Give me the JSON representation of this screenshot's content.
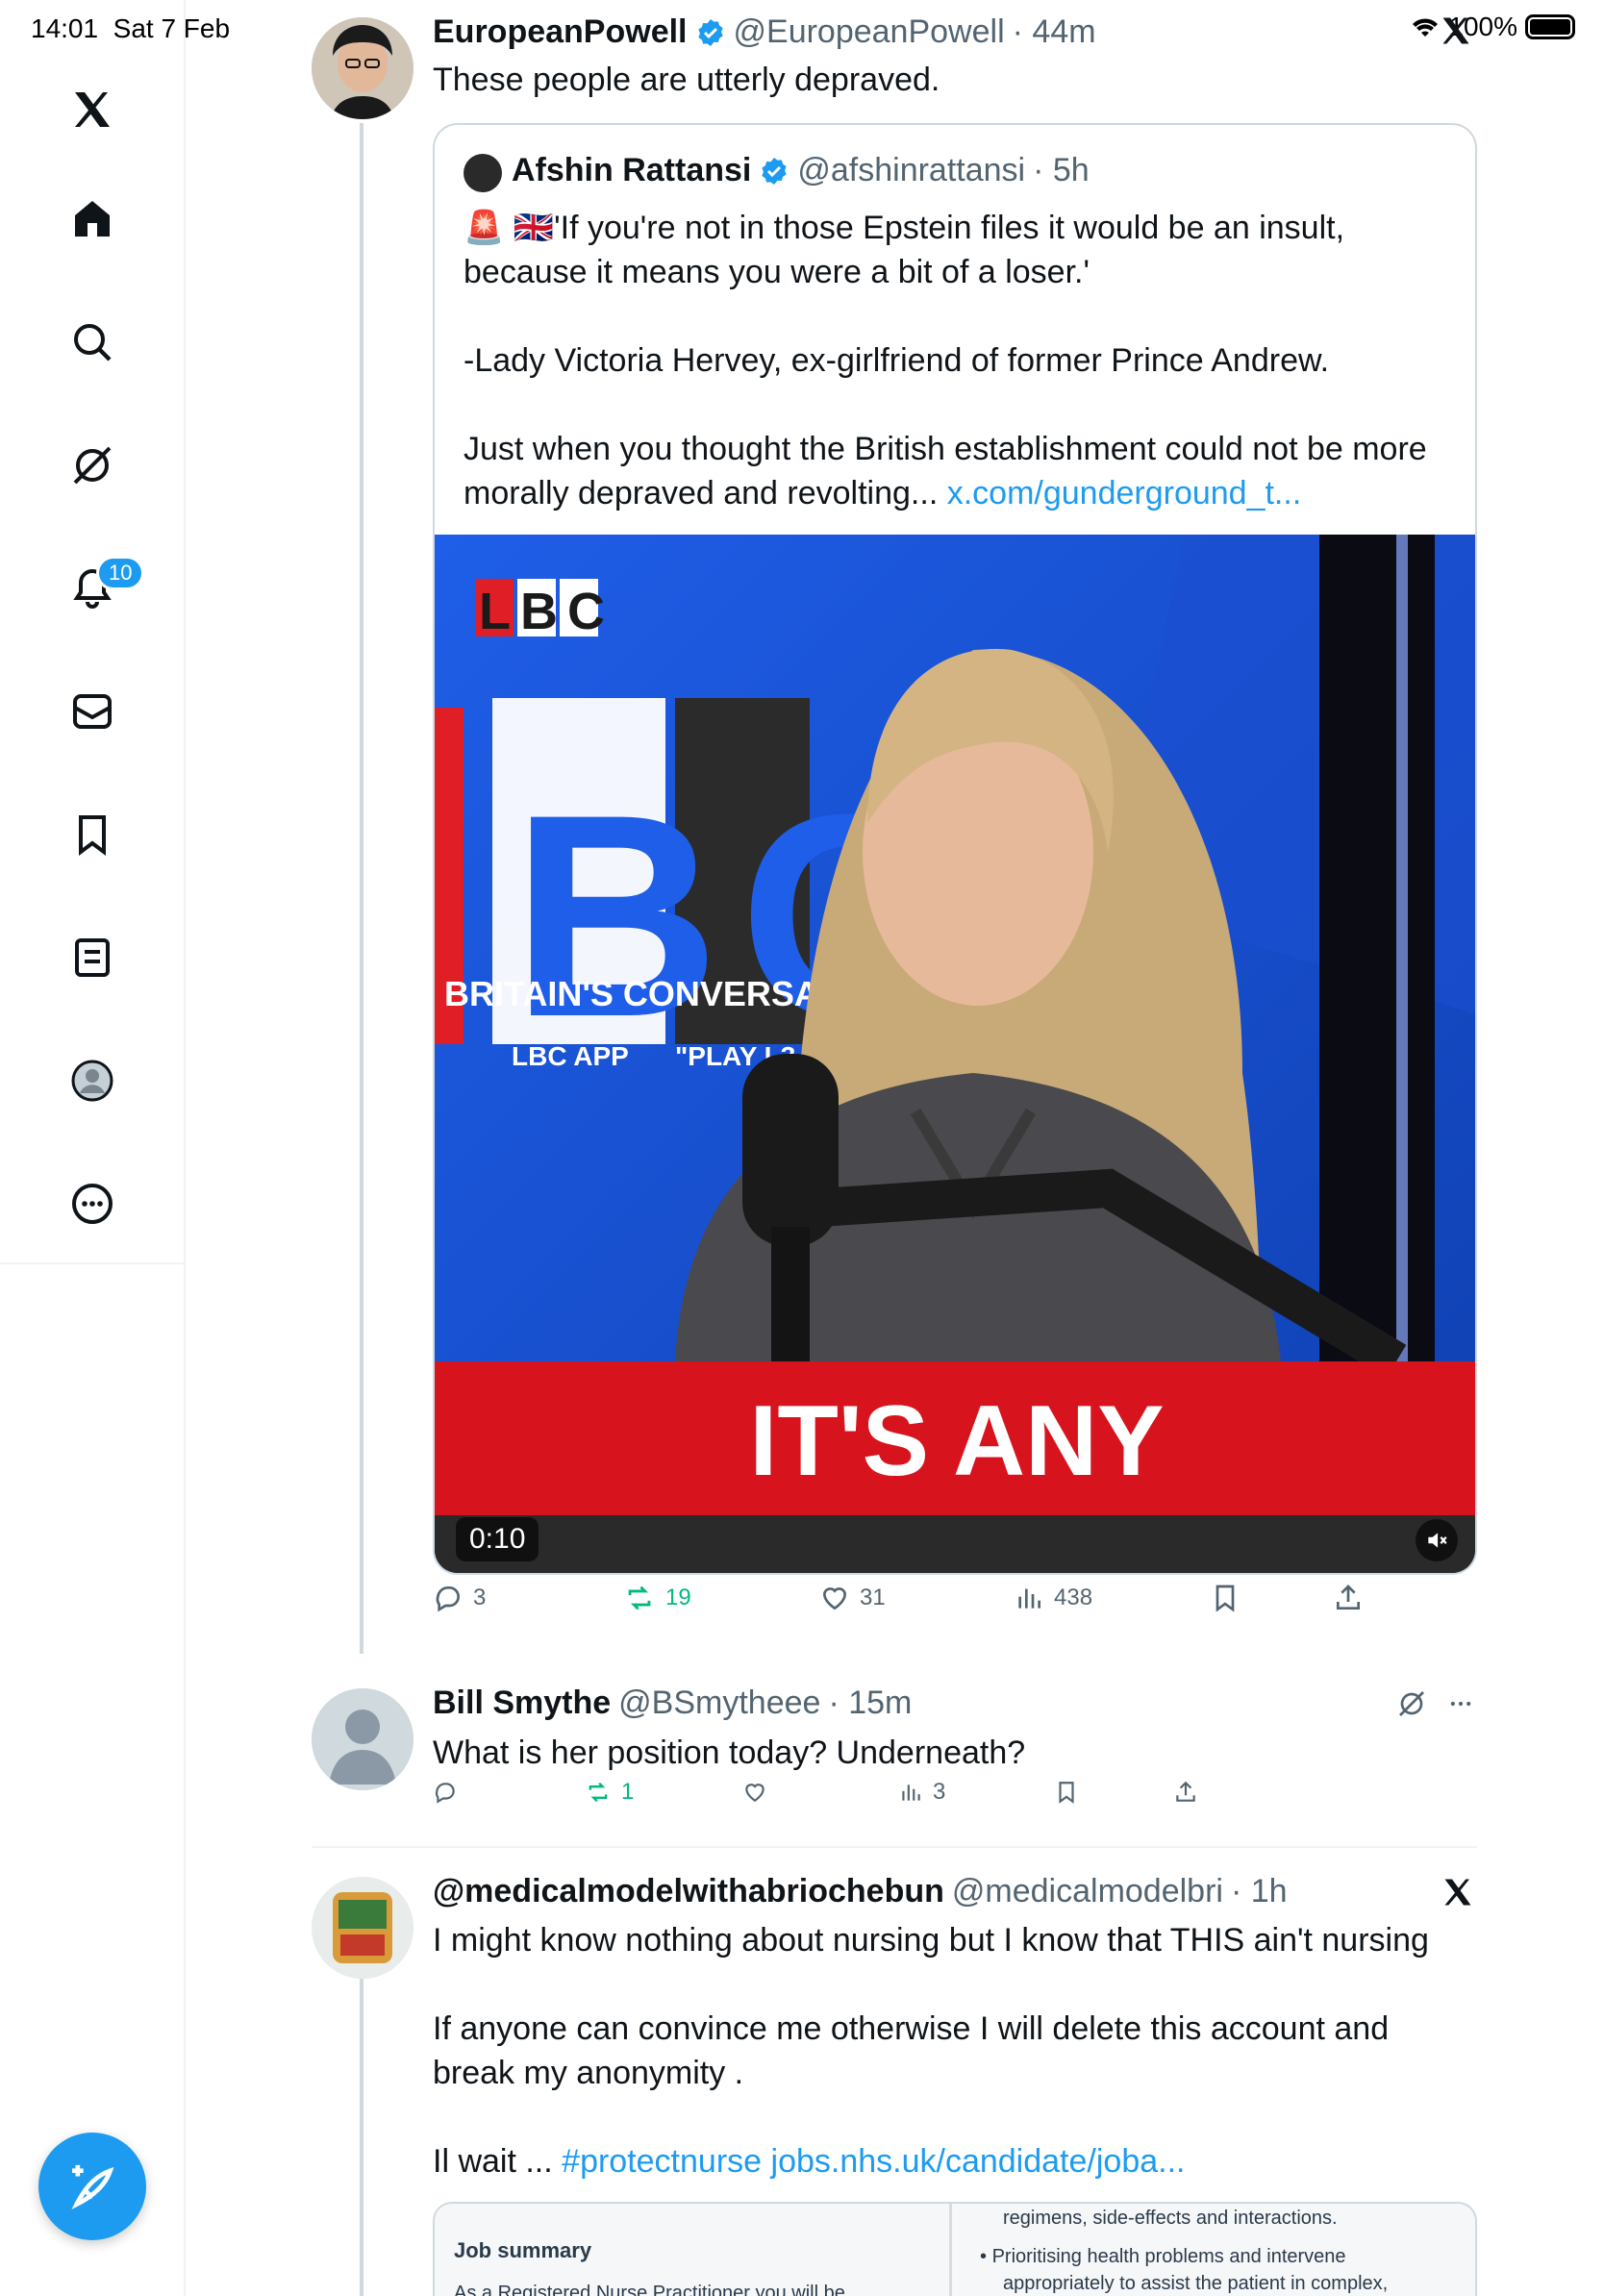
{
  "status_bar": {
    "time": "14:01",
    "date": "Sat 7 Feb",
    "battery": "100%"
  },
  "sidebar": {
    "items": [
      {
        "name": "x-logo"
      },
      {
        "name": "home"
      },
      {
        "name": "explore"
      },
      {
        "name": "grok"
      },
      {
        "name": "notifications",
        "badge": "10"
      },
      {
        "name": "messages"
      },
      {
        "name": "bookmarks"
      },
      {
        "name": "lists"
      },
      {
        "name": "profile"
      },
      {
        "name": "more"
      }
    ]
  },
  "main_tweet": {
    "name": "EuropeanPowell",
    "handle": "@EuropeanPowell",
    "time": "· 44m",
    "text": "These people are utterly depraved.",
    "quote": {
      "name": "Afshin Rattansi",
      "handle": "@afshinrattansi",
      "time": "· 5h",
      "emoji": "🚨 🇬🇧",
      "line1": "'If you're not in those Epstein files it would be an insult,",
      "line2": "because it means you were a bit of a loser.'",
      "line3": "-Lady Victoria Hervey, ex-girlfriend of former Prince Andrew.",
      "line4": "Just when you thought the British establishment could not be more",
      "line5": "morally depraved and revolting...",
      "link": "x.com/gunderground_t...",
      "video": {
        "duration": "0:10",
        "logo": "LBC",
        "big_logo": "BC",
        "tagline": "BRITAIN'S CONVERSATIO",
        "app_text": "LBC APP",
        "play_text": "\"PLAY L3",
        "caption": "IT'S ANY"
      }
    },
    "stats": {
      "replies": "3",
      "reposts": "19",
      "likes": "31",
      "views": "438"
    }
  },
  "reply": {
    "name": "Bill Smythe",
    "handle": "@BSmytheee",
    "time": "· 15m",
    "text": "What is her position today? Underneath?",
    "stats": {
      "reposts": "1",
      "views": "3"
    }
  },
  "third_tweet": {
    "name": "@medicalmodelwithabriochebun",
    "handle": "@medicalmodelbri",
    "time": "· 1h",
    "line1": "I might know nothing about nursing but I know that THIS ain't nursing",
    "line2": "If anyone can convince me otherwise I will delete this account and",
    "line3": "break my anonymity .",
    "line4": "Il wait ...",
    "hashtag": "#protectnurse",
    "link": "jobs.nhs.uk/candidate/joba...",
    "card": {
      "left_title": "Job summary",
      "left_text": "As a Registered Nurse Practitioner you will be",
      "right_line1": "regimens, side-effects and interactions.",
      "right_bullet": "Prioritising health problems and intervene",
      "right_line2": "appropriately to assist the patient in complex,"
    }
  },
  "colors": {
    "accent": "#1d9bf0",
    "repost": "#00ba7c",
    "text": "#0f1419",
    "secondary": "#536471"
  }
}
